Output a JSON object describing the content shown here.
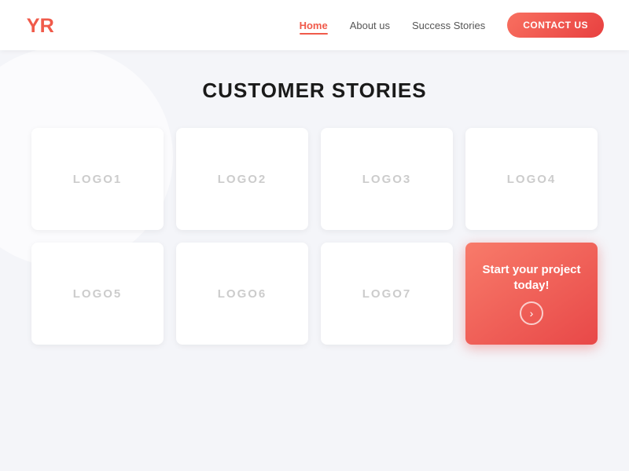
{
  "nav": {
    "logo_text": "YR",
    "links": [
      {
        "label": "Home",
        "active": true
      },
      {
        "label": "About us",
        "active": false
      },
      {
        "label": "Success Stories",
        "active": false
      }
    ],
    "contact_btn_label": "CONTACT US"
  },
  "main": {
    "title": "CUSTOMER STORIES",
    "logos": [
      {
        "id": 1,
        "label": "LOGO1"
      },
      {
        "id": 2,
        "label": "LOGO2"
      },
      {
        "id": 3,
        "label": "LOGO3"
      },
      {
        "id": 4,
        "label": "LOGO4"
      },
      {
        "id": 5,
        "label": "LOGO5"
      },
      {
        "id": 6,
        "label": "LOGO6"
      },
      {
        "id": 7,
        "label": "LOGO7"
      }
    ],
    "cta": {
      "text": "Start your project today!",
      "arrow": "›"
    }
  },
  "colors": {
    "accent": "#f05a4a",
    "cta_gradient_start": "#f87b6a",
    "cta_gradient_end": "#e84848"
  }
}
